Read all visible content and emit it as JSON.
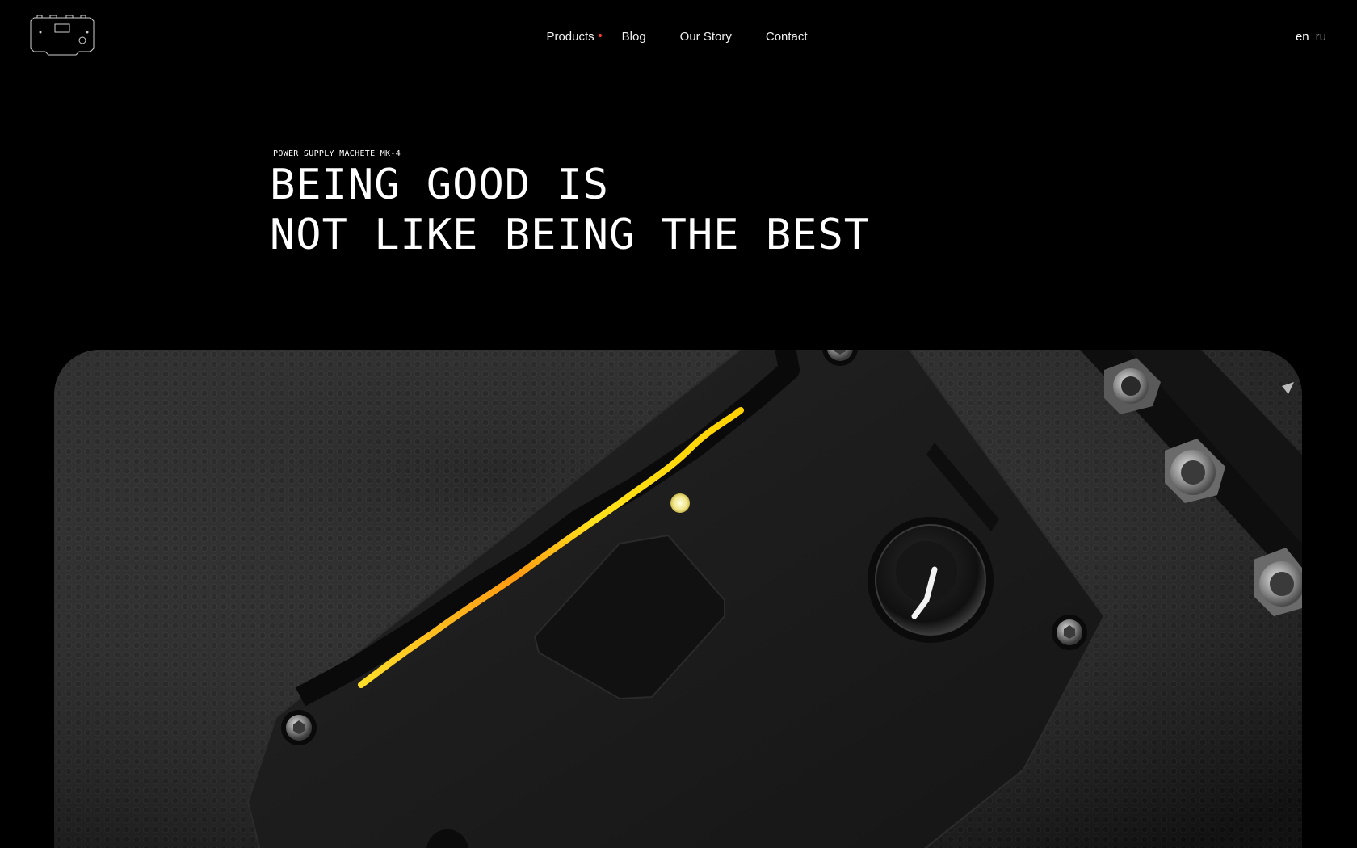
{
  "header": {
    "logo_icon": "device-outline-logo-icon",
    "nav": {
      "products": "Products",
      "blog": "Blog",
      "our_story": "Our Story",
      "contact": "Contact"
    },
    "languages": {
      "active": "en",
      "inactive": "ru"
    },
    "accent_color": "#ff3b2f"
  },
  "hero": {
    "eyebrow": "POWER SUPPLY MACHETE MK-4",
    "headline_line1": "BEING GOOD IS",
    "headline_line2": "NOT LIKE BEING THE BEST"
  },
  "visual": {
    "glow_color": "#ffd21a",
    "led_color": "#f5f0a0"
  }
}
